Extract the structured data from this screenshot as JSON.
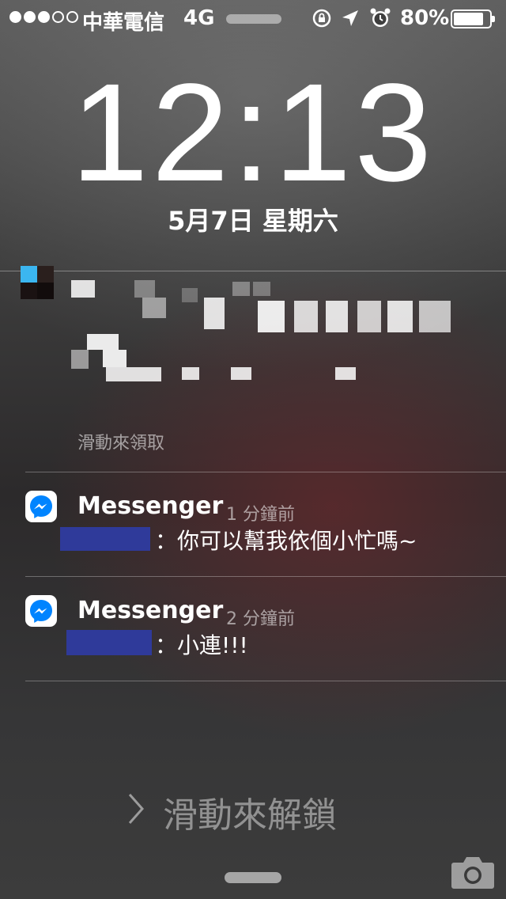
{
  "status_bar": {
    "carrier": "中華電信",
    "network": "4G",
    "battery_percent": "80%",
    "battery_level": 0.8,
    "signal_bars": 3,
    "signal_total": 5
  },
  "lock_screen": {
    "time": "12:13",
    "date": "5月7日 星期六"
  },
  "notifications": [
    {
      "app": "",
      "body": "",
      "action_hint": "滑動來領取",
      "redacted": true
    },
    {
      "app": "Messenger",
      "time_ago": "1 分鐘前",
      "message": "：你可以幫我依個小忙嗎~",
      "sender_redacted": true
    },
    {
      "app": "Messenger",
      "time_ago": "2 分鐘前",
      "message": "：小連!!!",
      "sender_redacted": true
    }
  ],
  "unlock": {
    "label": "滑動來解鎖"
  },
  "colors": {
    "redaction": "#2f3a9a",
    "messenger_blue": "#0084ff"
  },
  "icons": [
    "rotation-lock-icon",
    "location-arrow-icon",
    "alarm-clock-icon",
    "battery-icon",
    "messenger-icon",
    "chevron-right-icon",
    "camera-icon"
  ]
}
